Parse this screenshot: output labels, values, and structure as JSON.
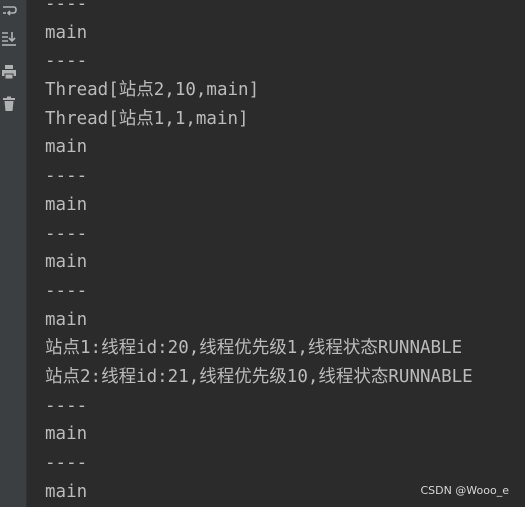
{
  "gutter": {
    "icons": [
      "soft-wrap-icon",
      "scroll-to-end-icon",
      "print-icon",
      "trash-icon"
    ]
  },
  "console": {
    "lines": [
      "----",
      "main",
      "----",
      "Thread[站点2,10,main]",
      "Thread[站点1,1,main]",
      "main",
      "----",
      "main",
      "----",
      "main",
      "----",
      "main",
      "站点1:线程id:20,线程优先级1,线程状态RUNNABLE",
      "站点2:线程id:21,线程优先级10,线程状态RUNNABLE",
      "----",
      "main",
      "----",
      "main"
    ]
  },
  "watermark": "CSDN @Wooo_e"
}
